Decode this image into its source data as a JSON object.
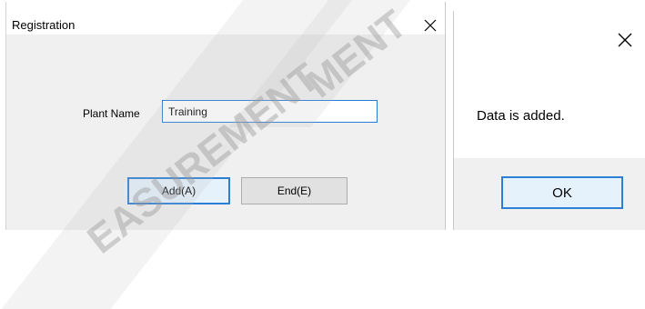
{
  "registration_dialog": {
    "title": "Registration",
    "close_icon": "close-icon",
    "plant_name_label": "Plant Name",
    "plant_name_value": "Training",
    "add_button": "Add(A)",
    "end_button": "End(E)"
  },
  "message_box": {
    "close_icon": "close-icon",
    "message": "Data is added.",
    "ok_button": "OK"
  },
  "watermark": {
    "line1": "MENT",
    "line2": "EASUREMENT"
  },
  "colors": {
    "dialog_bg": "#f0f0f0",
    "focus_border": "#2d7fd6",
    "button_bg": "#e1e1e1"
  }
}
